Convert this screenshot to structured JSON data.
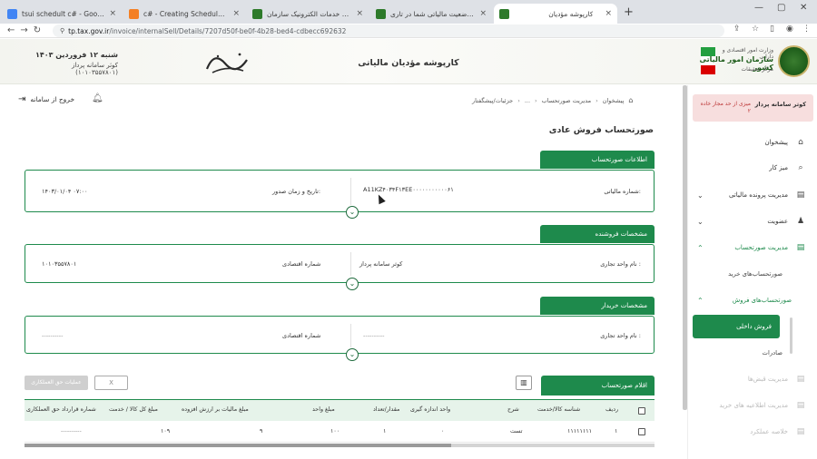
{
  "browser": {
    "tabs": [
      {
        "title": "tsui schedult c# - Google Search",
        "active": false,
        "color": "#4285f4"
      },
      {
        "title": "c# - Creating Scheduled Tasks - S",
        "active": false,
        "color": "#f48024"
      },
      {
        "title": "درگاه ملی خدمات الکترونیک سازمان",
        "active": false,
        "color": "#2d7a2a"
      },
      {
        "title": "خلاصه وضعیت مالیاتی شما در تاری",
        "active": false,
        "color": "#2d7a2a"
      },
      {
        "title": "کارپوشه مؤدیان",
        "active": true,
        "color": "#2d7a2a"
      }
    ],
    "new_tab": "+",
    "url_host": "tp.tax.gov.ir",
    "url_path": "/invoice/internalSell/Details/7207d50f-be0f-4b28-bed4-cdbecc692632"
  },
  "header": {
    "site_title": "کارپوشه مؤدیان مالیاتی",
    "org_line1": "وزارت امور اقتصادی و دارایی",
    "org_line2": "سازمان امور مالیاتی کشور",
    "org_line3": "مرکز تحقیقات",
    "date": "شنبه ۱۲ فروردین ۱۴۰۳",
    "user": "کوثر سامانه پرداز (۱۰۱۰۳۵۵۷۸۰۱)"
  },
  "topbar": {
    "logout": "خروج از سامانه",
    "breadcrumb": [
      "پیشخوان",
      "مدیریت صورتحساب",
      "...",
      "جزئیات/پیشگفتار"
    ]
  },
  "sidebar": {
    "user_name": "کوثر سامانه پرداز",
    "user_status": "میزی از حد مجاز خاده ۲",
    "items": [
      {
        "label": "پیشخوان",
        "icon": "⌂"
      },
      {
        "label": "میز کار",
        "icon": "⌕"
      },
      {
        "label": "مدیریت پرونده مالیاتی",
        "icon": "▤",
        "chevron": "⌄"
      },
      {
        "label": "عضویت",
        "icon": "♟",
        "chevron": "⌄"
      },
      {
        "label": "مدیریت صورتحساب",
        "icon": "▤",
        "chevron": "⌃"
      }
    ],
    "sub_purchase": "صورتحساب‌های خرید",
    "sub_sales": "صورتحساب‌های فروش",
    "active": "فروش داخلی",
    "export": "صادرات",
    "disabled": [
      "مدیریت قبض‌ها",
      "مدیریت اطلاعیه های خرید",
      "خلاصه عملکرد"
    ]
  },
  "main": {
    "page_title": "صورتحساب فروش عادی",
    "invoice_info": {
      "tab": "اطلاعات صورتحساب",
      "tax_no_label": "شماره مالیاتی:",
      "tax_no_value": "A11KZ۴۰۳۴F۱۳EE۰۰۰۰۰۰۰۰۰۰۰۶۱",
      "issue_label": "تاریخ و زمان صدور:",
      "issue_value": "۱۴۰۳/۰۱/۰۴ ۰۷:۰۰"
    },
    "seller": {
      "tab": "مشخصات فروشنده",
      "trade_label": "نام واحد تجاری :",
      "trade_value": "کوثر سامانه پرداز",
      "econ_label": "شماره اقتصادی",
      "econ_value": "۱۰۱۰۳۵۵۷۸۰۱"
    },
    "buyer": {
      "tab": "مشخصات خریدار",
      "trade_label": "نام واحد تجاری :",
      "trade_value": "----------",
      "econ_label": "شماره اقتصادی",
      "econ_value": "----------"
    },
    "items": {
      "tab": "اقلام صورتحساب",
      "btn_x": "X",
      "btn_tag": "عملیات حق العملکاری",
      "headers": [
        "ردیف",
        "شناسه کالا/خدمت",
        "شرح",
        "واحد اندازه گیری",
        "مقدار/تعداد",
        "مبلغ واحد",
        "مبلغ مالیات بر ارزش افزوده",
        "مبلغ کل کالا / خدمت",
        "شماره قرارداد حق العملکاری"
      ],
      "row": [
        "۱",
        "۱۱۱۱۱۱۱۱",
        "تست",
        "۰",
        "۱",
        "۱۰۰",
        "۹",
        "۱۰۹",
        "----------"
      ]
    }
  }
}
